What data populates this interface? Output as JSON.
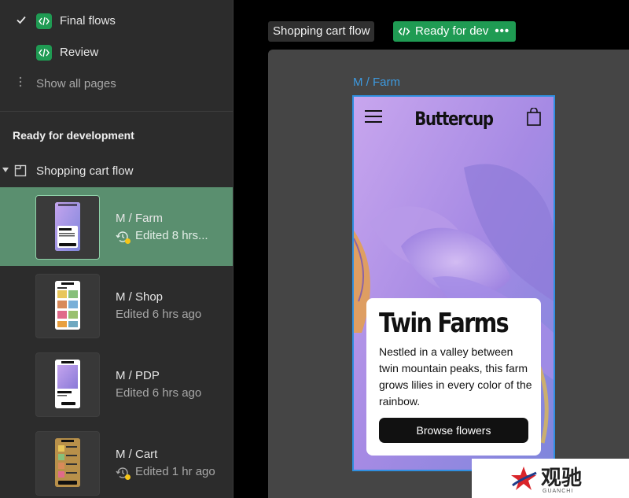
{
  "sidebar": {
    "pages": [
      {
        "label": "Final flows",
        "checked": true
      },
      {
        "label": "Review",
        "checked": false
      }
    ],
    "show_all_label": "Show all pages",
    "section_title": "Ready for development",
    "flow": {
      "label": "Shopping cart flow",
      "frames": [
        {
          "name": "M / Farm",
          "edited": "Edited 8 hrs...",
          "active": true,
          "has_update": true
        },
        {
          "name": "M / Shop",
          "edited": "Edited 6 hrs ago",
          "active": false,
          "has_update": false
        },
        {
          "name": "M / PDP",
          "edited": "Edited 6 hrs ago",
          "active": false,
          "has_update": false
        },
        {
          "name": "M / Cart",
          "edited": "Edited 1 hr ago",
          "active": false,
          "has_update": true
        }
      ]
    }
  },
  "canvas": {
    "flow_tag": "Shopping cart flow",
    "status_tag": "Ready for dev",
    "status_more": "•••",
    "frame_tag": "M / Farm",
    "phone": {
      "brand": "Buttercup",
      "card_title": "Twin Farms",
      "card_body": "Nestled in a valley between twin mountain peaks, this farm grows lilies in every color of the rainbow.",
      "button_label": "Browse flowers"
    }
  },
  "watermark": {
    "text": "观驰",
    "sub": "GUANCHI"
  },
  "colors": {
    "sidebar_bg": "#2c2c2c",
    "active_row": "#5a8f6f",
    "dev_green": "#1f9b53",
    "selection_blue": "#2f8fe0",
    "update_dot": "#f5c518"
  }
}
